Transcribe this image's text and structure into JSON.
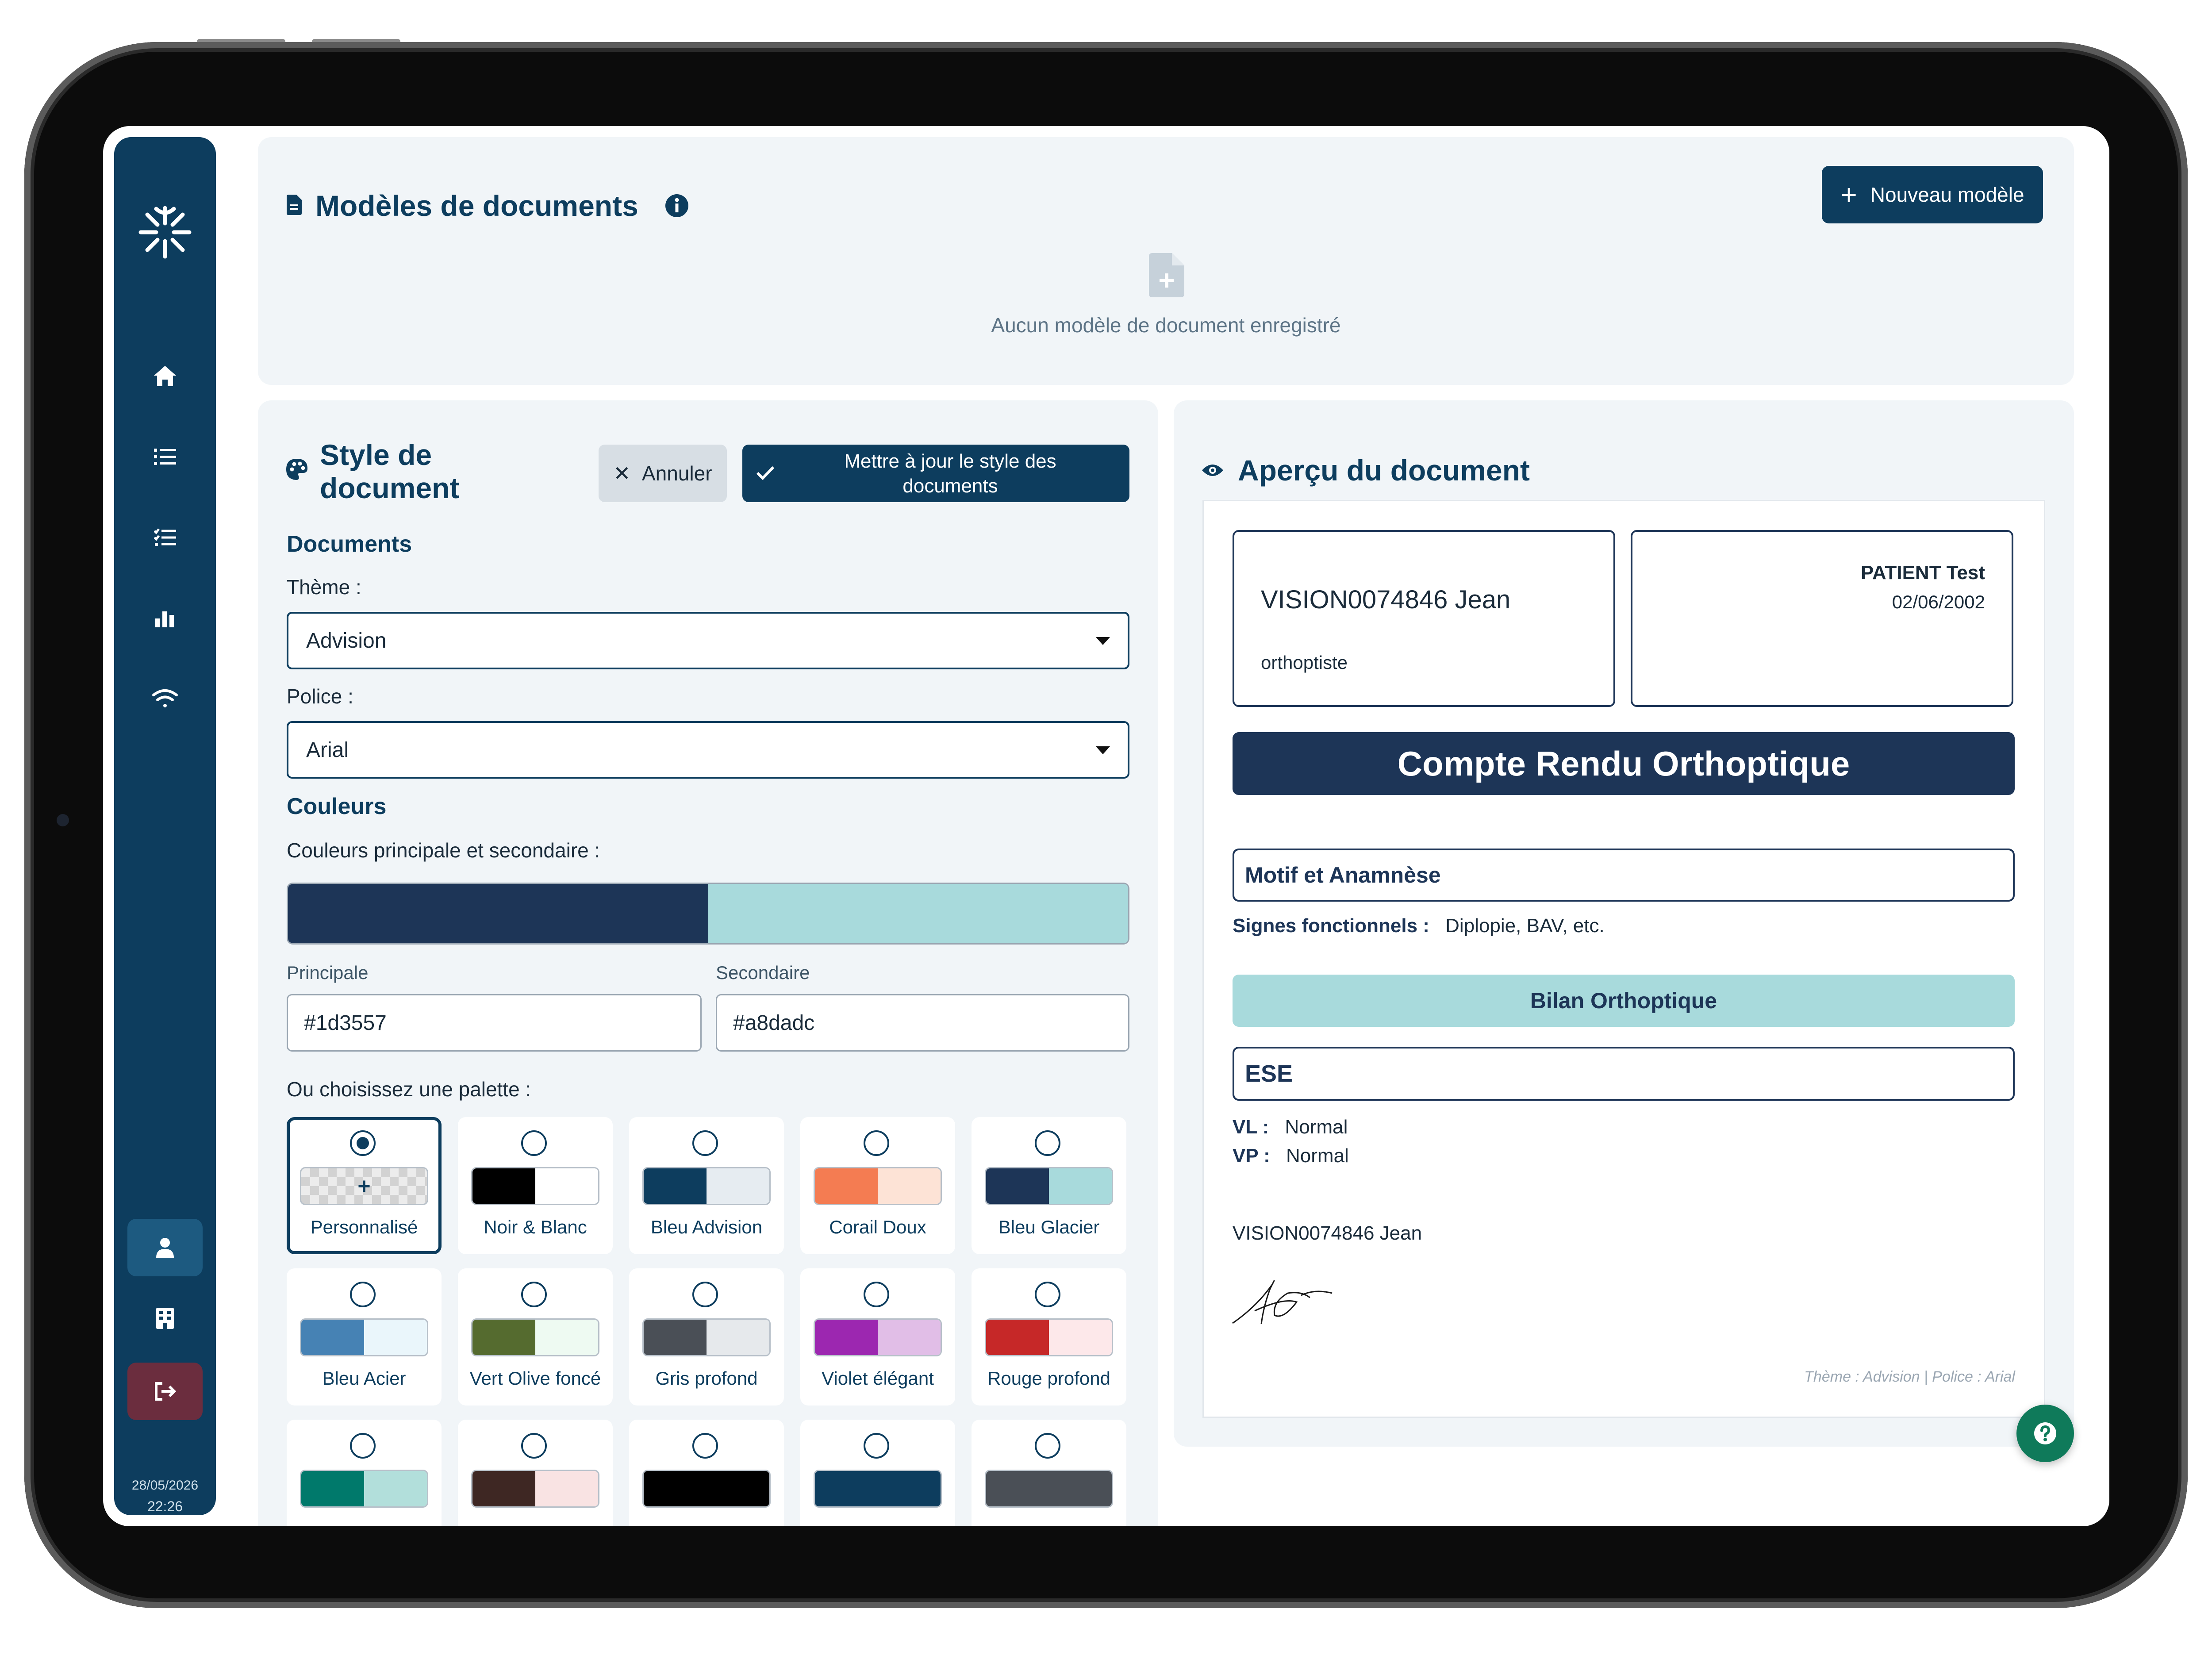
{
  "header": {
    "title": "Modèles de documents",
    "new_button": "Nouveau modèle",
    "empty_text": "Aucun modèle de document enregistré"
  },
  "style_panel": {
    "title_line1": "Style de",
    "title_line2": "document",
    "cancel_label": "Annuler",
    "update_label_line1": "Mettre à jour le style des",
    "update_label_line2": "documents",
    "documents_heading": "Documents",
    "theme_label": "Thème :",
    "theme_value": "Advision",
    "font_label": "Police :",
    "font_value": "Arial",
    "colors_heading": "Couleurs",
    "colors_subheading": "Couleurs principale et secondaire :",
    "primary_label": "Principale",
    "secondary_label": "Secondaire",
    "primary_value": "#1d3557",
    "secondary_value": "#a8dadc",
    "palette_heading": "Ou choisissez une palette :",
    "palettes": [
      {
        "name": "Personnalisé",
        "selected": true,
        "colors": [
          "custom"
        ]
      },
      {
        "name": "Noir & Blanc",
        "colors": [
          "#000000",
          "#ffffff"
        ]
      },
      {
        "name": "Bleu Advision",
        "colors": [
          "#0d3d5e",
          "#e6ecf1"
        ]
      },
      {
        "name": "Corail Doux",
        "colors": [
          "#f47c52",
          "#fde3d6"
        ]
      },
      {
        "name": "Bleu Glacier",
        "colors": [
          "#1d3557",
          "#a8dadc"
        ]
      },
      {
        "name": "Bleu Acier",
        "colors": [
          "#4682b4",
          "#eaf6fb"
        ]
      },
      {
        "name": "Vert Olive foncé",
        "colors": [
          "#556b2f",
          "#eefaf2"
        ]
      },
      {
        "name": "Gris profond",
        "colors": [
          "#4a4f56",
          "#e6e9ec"
        ]
      },
      {
        "name": "Violet élégant",
        "colors": [
          "#9c27b0",
          "#e1bee7"
        ]
      },
      {
        "name": "Rouge profond",
        "colors": [
          "#c62828",
          "#fde8ea"
        ]
      },
      {
        "name": "",
        "colors": [
          "#00796b",
          "#b2dfdb"
        ]
      },
      {
        "name": "",
        "colors": [
          "#3e2723",
          "#f9e3e3"
        ]
      },
      {
        "name": "",
        "colors": [
          "#000000"
        ]
      },
      {
        "name": "",
        "colors": [
          "#0d3d5e"
        ]
      },
      {
        "name": "",
        "colors": [
          "#4a4f56"
        ]
      }
    ]
  },
  "preview": {
    "title": "Aperçu du document",
    "practitioner_name": "VISION0074846 Jean",
    "practitioner_role": "orthoptiste",
    "patient_name": "PATIENT Test",
    "patient_dob": "02/06/2002",
    "report_title": "Compte Rendu Orthoptique",
    "section1": "Motif et Anamnèse",
    "signs_label": "Signes fonctionnels :",
    "signs_value": "Diplopie, BAV, etc.",
    "section2": "Bilan Orthoptique",
    "section3": "ESE",
    "vl_label": "VL :",
    "vl_value": "Normal",
    "vp_label": "VP :",
    "vp_value": "Normal",
    "signature_name": "VISION0074846 Jean",
    "footer": "Thème : Advision | Police : Arial"
  },
  "sidebar": {
    "items": [
      "home-icon",
      "list-icon",
      "checklist-icon",
      "bar-chart-icon",
      "wifi-icon"
    ],
    "date": "28/05/2026",
    "time": "22:26"
  },
  "colors": {
    "brand": "#0d3d5e",
    "primary": "#1d3557",
    "secondary": "#a8dadc",
    "logout": "#6b2d3e",
    "help": "#0f7a5a"
  }
}
